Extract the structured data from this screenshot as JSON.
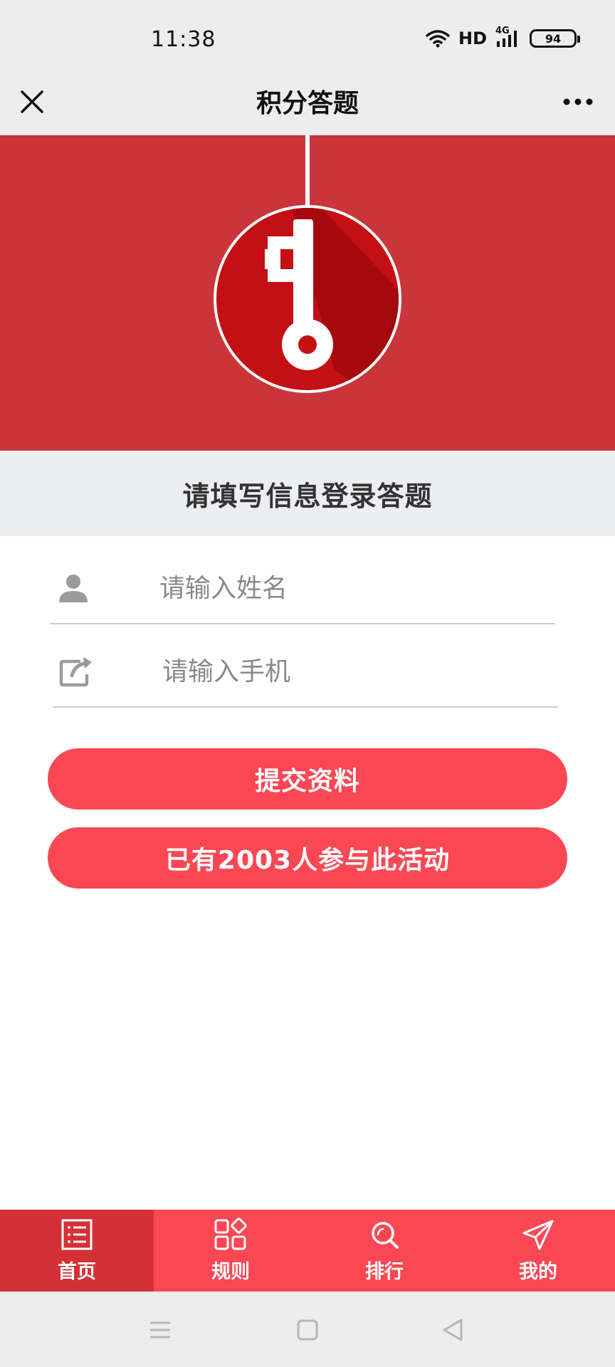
{
  "status_bar": {
    "time": "11:38",
    "network": "HD",
    "signal": "4G",
    "battery": "94"
  },
  "header": {
    "title": "积分答题",
    "close_icon": "close-icon",
    "more_icon": "more-icon"
  },
  "login": {
    "title": "请填写信息登录答题",
    "name_placeholder": "请输入姓名",
    "phone_placeholder": "请输入手机",
    "submit_label": "提交资料",
    "participants_label": "已有2003人参与此活动"
  },
  "bottom_nav": {
    "items": [
      {
        "label": "首页",
        "icon": "list-icon",
        "active": true
      },
      {
        "label": "规则",
        "icon": "grid-icon",
        "active": false
      },
      {
        "label": "排行",
        "icon": "search-icon",
        "active": false
      },
      {
        "label": "我的",
        "icon": "send-icon",
        "active": false
      }
    ]
  },
  "colors": {
    "banner": "#c9353b",
    "accent": "#fa4753",
    "nav_active": "#d53035"
  }
}
